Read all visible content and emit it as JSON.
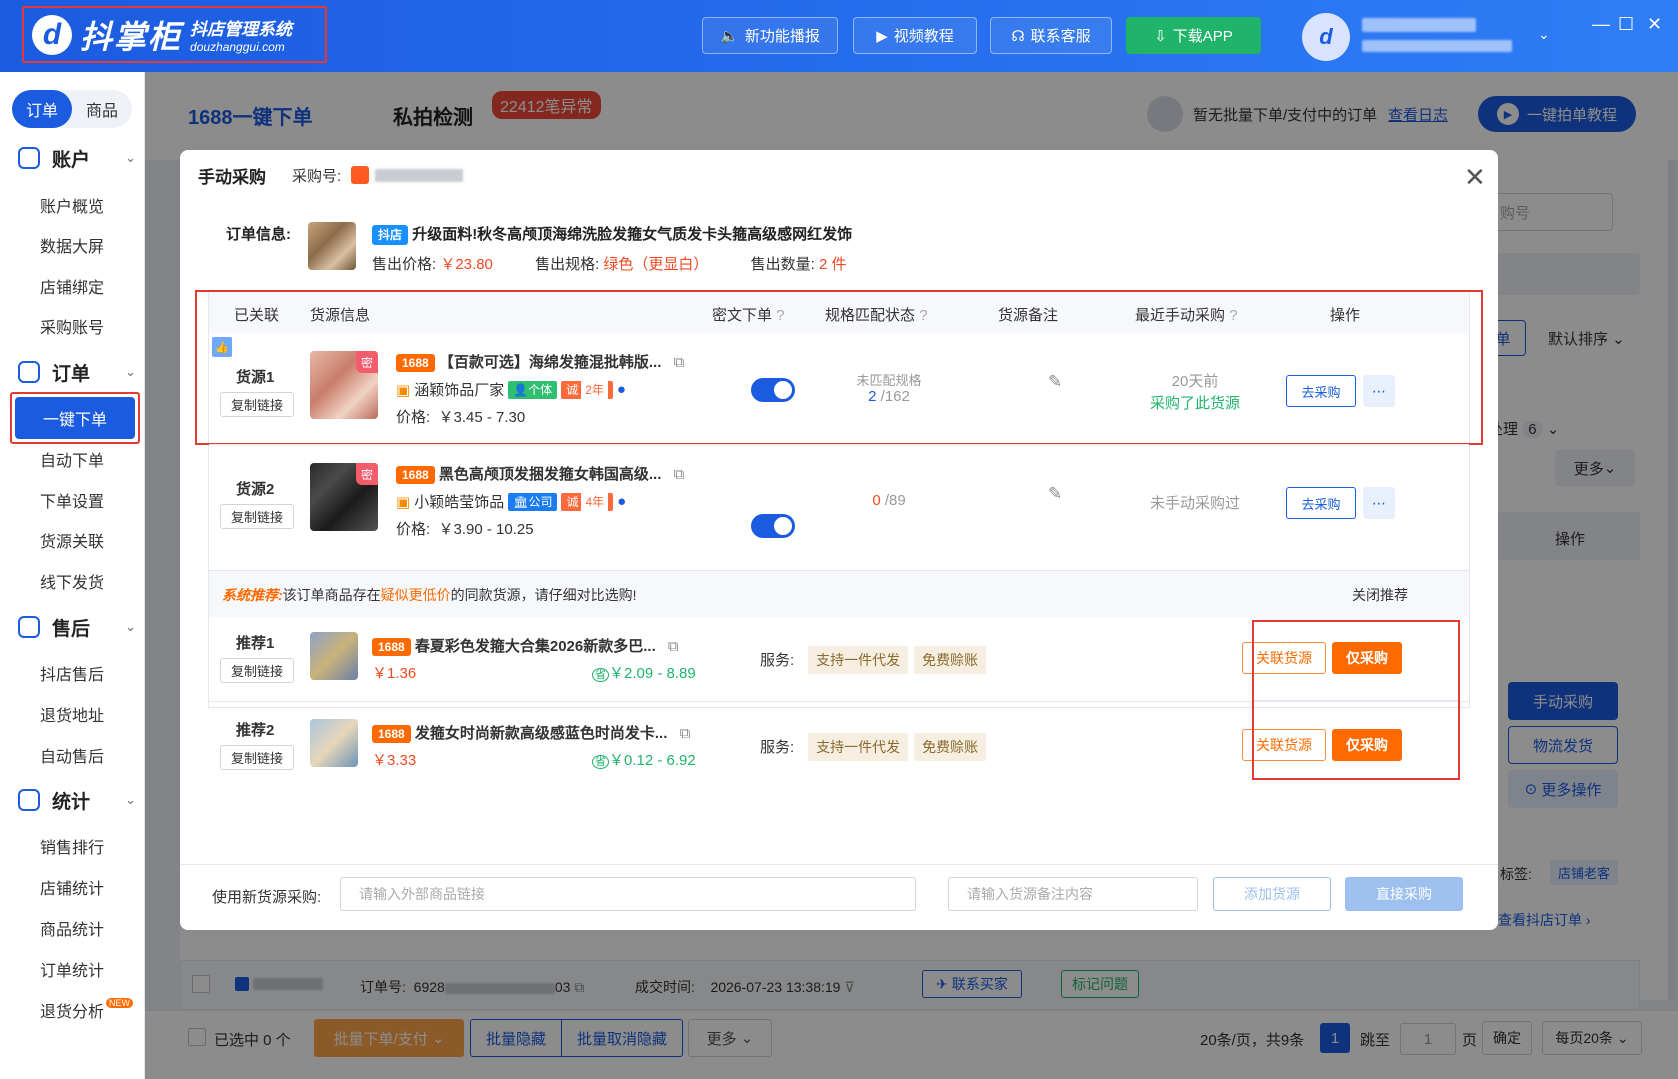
{
  "app": {
    "brand": "抖掌柜",
    "brand_tagline": "抖店管理系统",
    "brand_domain": "douzhanggui.com",
    "topbar_buttons": [
      "新功能播报",
      "视频教程",
      "联系客服",
      "下载APP"
    ]
  },
  "sidebar": {
    "tabs": [
      "订单",
      "商品"
    ],
    "sections": [
      {
        "title": "账户",
        "items": [
          "账户概览",
          "数据大屏",
          "店铺绑定",
          "采购账号"
        ]
      },
      {
        "title": "订单",
        "items": [
          "一键下单",
          "自动下单",
          "下单设置",
          "货源关联",
          "线下发货"
        ]
      },
      {
        "title": "售后",
        "items": [
          "抖店售后",
          "退货地址",
          "自动售后"
        ]
      },
      {
        "title": "统计",
        "items": [
          "销售排行",
          "店铺统计",
          "商品统计",
          "订单统计",
          "退货分析"
        ]
      }
    ],
    "new_badge": "NEW"
  },
  "main": {
    "tab_active": "1688一键下单",
    "tab_other": "私拍检测",
    "anomaly_badge": "22412笔异常",
    "status_text": "暂无批量下单/支付中的订单",
    "view_log": "查看日志",
    "tutorial_button": "一键拍单教程",
    "bg": {
      "search_placeholder_tail": "购号",
      "btn_single": "单",
      "sort": "默认排序",
      "handle": "处理",
      "handle_count": "6",
      "more": "更多",
      "col_action": "操作",
      "manual_buy": "手动采购",
      "logistics": "物流发货",
      "more_ops": "更多操作",
      "tag_label": "标签:",
      "tag_value": "店铺老客",
      "view_order": "查看抖店订单 ›"
    },
    "order_row": {
      "order_no_label": "订单号:",
      "order_no_prefix": "6928",
      "order_no_suffix": "03",
      "deal_time_label": "成交时间:",
      "deal_time": "2026-07-23 13:38:19",
      "contact_buyer": "联系买家",
      "mark_issue": "标记问题"
    },
    "footer": {
      "selected": "已选中 0 个",
      "batch_order": "批量下单/支付",
      "batch_hide": "批量隐藏",
      "batch_unhide": "批量取消隐藏",
      "more": "更多",
      "page_info_pre": "20条/页，共",
      "page_info_num": "9",
      "page_info_post": "条",
      "current_page": "1",
      "jump": "跳至",
      "jump_value": "1",
      "page_unit": "页",
      "confirm": "确定",
      "page_size": "每页20条"
    }
  },
  "modal": {
    "title": "手动采购",
    "purchase_no_label": "采购号:",
    "order_info_label": "订单信息:",
    "platform_tag": "抖店",
    "product_title": "升级面料!秋冬高颅顶海绵洗脸发箍女气质发卡头箍高级感网红发饰",
    "sale_price_label": "售出价格:",
    "sale_price": "￥23.80",
    "sale_spec_label": "售出规格:",
    "sale_spec": "绿色（更显白）",
    "sale_qty_label": "售出数量:",
    "sale_qty": "2 件",
    "table_headers": [
      "已关联",
      "货源信息",
      "密文下单",
      "规格匹配状态",
      "货源备注",
      "最近手动采购",
      "操作"
    ],
    "sources": [
      {
        "label": "货源1",
        "copy": "复制链接",
        "tag": "1688",
        "title": "【百款可选】海绵发箍混批韩版...",
        "shop": "涵颖饰品厂家",
        "shop_type": "个体",
        "years": "2年",
        "price_label": "价格:",
        "price": "￥3.45 - 7.30",
        "match_status": "未匹配规格",
        "match_num": "2",
        "match_total": "/162",
        "recent_line1": "20天前",
        "recent_line2": "采购了此货源",
        "action": "去采购",
        "secret": "密"
      },
      {
        "label": "货源2",
        "copy": "复制链接",
        "tag": "1688",
        "title": "黑色高颅顶发捆发箍女韩国高级...",
        "shop": "小颖皓莹饰品",
        "shop_type": "公司",
        "years": "4年",
        "price_label": "价格:",
        "price": "￥3.90 - 10.25",
        "match_status": "",
        "match_num": "0",
        "match_total": "/89",
        "recent_line1": "未手动采购过",
        "recent_line2": "",
        "action": "去采购",
        "secret": "密"
      }
    ],
    "recommend": {
      "head_label": "系统推荐:",
      "head_text_pre": "该订单商品存在",
      "head_text_hl": "疑似更低价",
      "head_text_post": "的同款货源，请仔细对比选购!",
      "close": "关闭推荐",
      "items": [
        {
          "label": "推荐1",
          "copy": "复制链接",
          "tag": "1688",
          "title": "春夏彩色发箍大合集2026新款多巴...",
          "price": "￥1.36",
          "range": "￥2.09 - 8.89",
          "service_label": "服务:",
          "services": [
            "支持一件代发",
            "免费赊账"
          ],
          "relate": "关联货源",
          "buy": "仅采购"
        },
        {
          "label": "推荐2",
          "copy": "复制链接",
          "tag": "1688",
          "title": "发箍女时尚新款高级感蓝色时尚发卡...",
          "price": "￥3.33",
          "range": "￥0.12 - 6.92",
          "service_label": "服务:",
          "services": [
            "支持一件代发",
            "免费赊账"
          ],
          "relate": "关联货源",
          "buy": "仅采购"
        }
      ]
    },
    "bottom": {
      "label": "使用新货源采购:",
      "link_placeholder": "请输入外部商品链接",
      "note_placeholder": "请输入货源备注内容",
      "add": "添加货源",
      "direct": "直接采购"
    },
    "provenance_icon": "省"
  }
}
